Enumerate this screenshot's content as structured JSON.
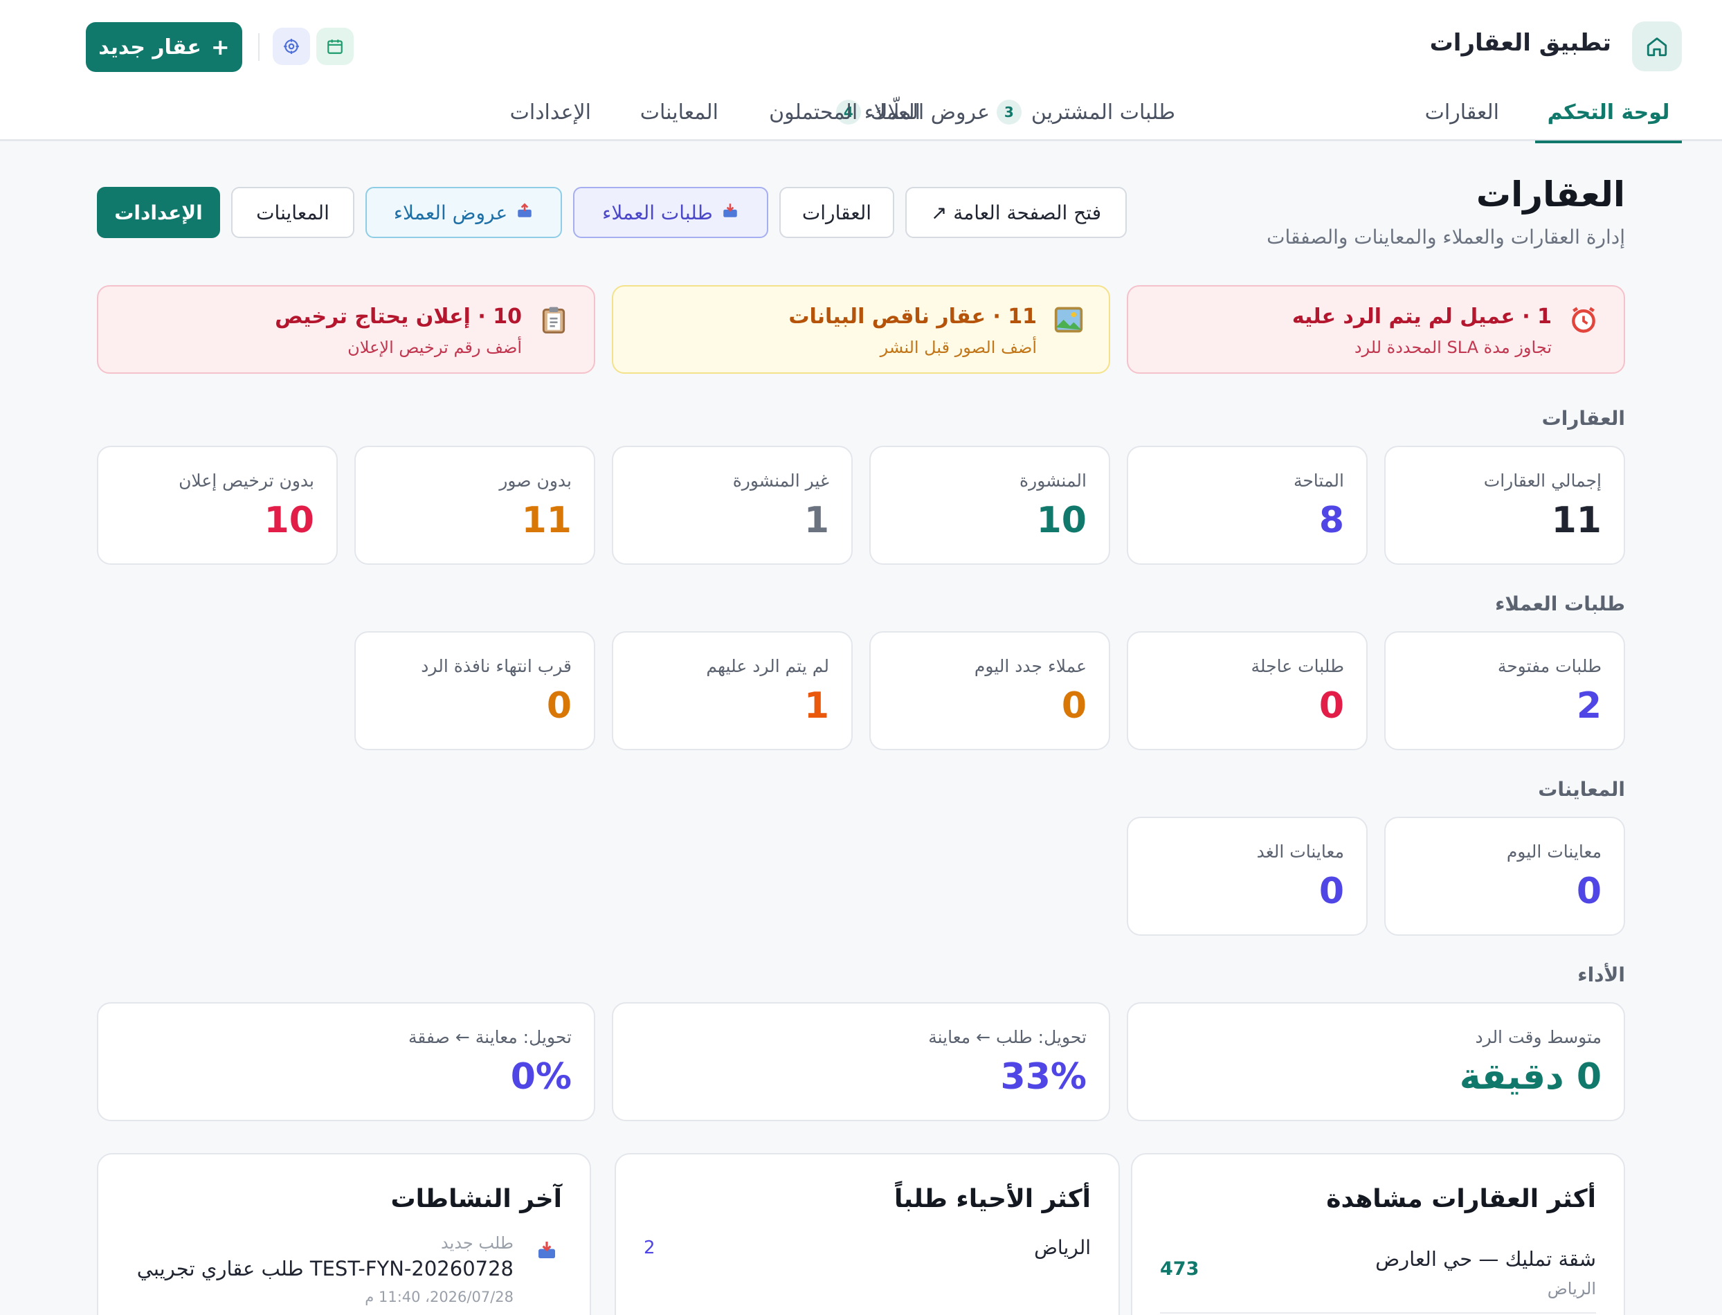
{
  "header": {
    "app_title": "تطبيق العقارات",
    "new_property_label": "عقار جديد",
    "plus_symbol": "+"
  },
  "nav": {
    "tabs": [
      {
        "label": "لوحة التحكم",
        "active": true
      },
      {
        "label": "العقارات"
      },
      {
        "label": "طلبات المشترين",
        "badge": "3"
      },
      {
        "label": "عروض الملّاك",
        "badge": "4"
      },
      {
        "label": "العملاء المحتملون"
      },
      {
        "label": "المعاينات"
      },
      {
        "label": "الإعدادات"
      }
    ]
  },
  "page": {
    "title": "العقارات",
    "subtitle": "إدارة العقارات والعملاء والمعاينات والصفقات"
  },
  "actions": {
    "open_public_page": "فتح الصفحة العامة ↗",
    "properties": "العقارات",
    "client_requests": "طلبات العملاء",
    "client_offers": "عروض العملاء",
    "viewings": "المعاينات",
    "settings": "الإعدادات"
  },
  "alerts": [
    {
      "title": "1 · عميل لم يتم الرد عليه",
      "subtitle": "تجاوز مدة SLA المحددة للرد",
      "icon": "alarm-clock-icon"
    },
    {
      "title": "11 · عقار ناقص البيانات",
      "subtitle": "أضف الصور قبل النشر",
      "icon": "picture-icon"
    },
    {
      "title": "10 · إعلان يحتاج ترخيص",
      "subtitle": "أضف رقم ترخيص الإعلان",
      "icon": "clipboard-icon"
    }
  ],
  "sections": {
    "properties": {
      "label": "العقارات",
      "stats": [
        {
          "label": "إجمالي العقارات",
          "value": "11",
          "color": "#1f2430"
        },
        {
          "label": "المتاحة",
          "value": "8",
          "color": "#4f46e5"
        },
        {
          "label": "المنشورة",
          "value": "10",
          "color": "#11796b"
        },
        {
          "label": "غير المنشورة",
          "value": "1",
          "color": "#6b7280"
        },
        {
          "label": "بدون صور",
          "value": "11",
          "color": "#d97706"
        },
        {
          "label": "بدون ترخيص إعلان",
          "value": "10",
          "color": "#e11d48"
        }
      ]
    },
    "requests": {
      "label": "طلبات العملاء",
      "stats": [
        {
          "label": "طلبات مفتوحة",
          "value": "2",
          "color": "#4f46e5"
        },
        {
          "label": "طلبات عاجلة",
          "value": "0",
          "color": "#e11d48"
        },
        {
          "label": "عملاء جدد اليوم",
          "value": "0",
          "color": "#d97706"
        },
        {
          "label": "لم يتم الرد عليهم",
          "value": "1",
          "color": "#ea580c"
        },
        {
          "label": "قرب انتهاء نافذة الرد",
          "value": "0",
          "color": "#d97706"
        }
      ]
    },
    "viewings": {
      "label": "المعاينات",
      "stats": [
        {
          "label": "معاينات اليوم",
          "value": "0",
          "color": "#4f46e5"
        },
        {
          "label": "معاينات الغد",
          "value": "0",
          "color": "#4f46e5"
        }
      ]
    },
    "performance": {
      "label": "الأداء",
      "stats": [
        {
          "label": "متوسط وقت الرد",
          "value": "0 دقيقة",
          "color": "#11796b"
        },
        {
          "label": "تحويل: طلب ← معاينة",
          "value": "33%",
          "color": "#4f46e5"
        },
        {
          "label": "تحويل: معاينة ← صفقة",
          "value": "0%",
          "color": "#4f46e5"
        }
      ]
    }
  },
  "panels": {
    "most_viewed": {
      "title": "أكثر العقارات مشاهدة",
      "items": [
        {
          "name": "شقة تمليك — حي العارض",
          "city": "الرياض",
          "views": "473"
        }
      ]
    },
    "top_districts": {
      "title": "أكثر الأحياء طلباً",
      "items": [
        {
          "name": "الرياض",
          "count": "2"
        }
      ]
    },
    "recent_activity": {
      "title": "آخر النشاطات",
      "items": [
        {
          "type": "طلب جديد",
          "text": "TEST-FYN-20260728 طلب عقاري تجريبي",
          "time": "2026/07/28، 11:40 م"
        }
      ]
    }
  }
}
